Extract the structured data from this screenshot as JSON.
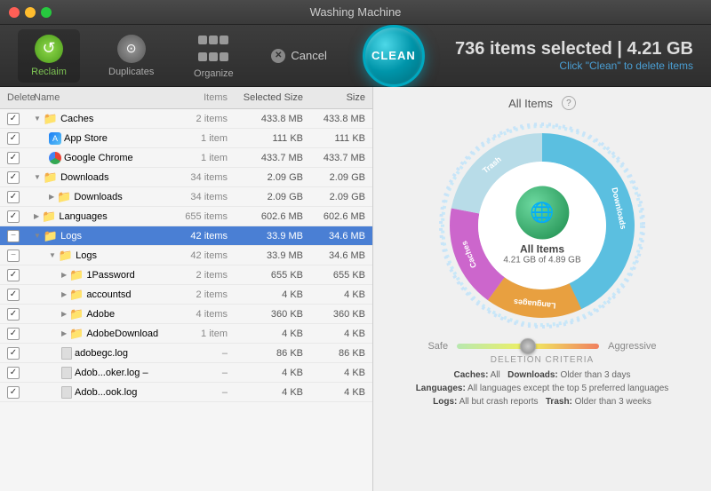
{
  "app": {
    "title": "Washing Machine"
  },
  "toolbar": {
    "reclaim_label": "Reclaim",
    "duplicates_label": "Duplicates",
    "organize_label": "Organize",
    "cancel_label": "Cancel",
    "clean_label": "CLEAN"
  },
  "header": {
    "selected_text": "736 items selected | 4.21 GB",
    "hint_text": "Click \"Clean\" to delete items"
  },
  "panel_title": "All Items",
  "columns": {
    "delete": "Delete",
    "name": "Name",
    "items": "Items",
    "selected_size": "Selected Size",
    "size": "Size"
  },
  "rows": [
    {
      "level": 0,
      "expanded": true,
      "checked": "checked",
      "name": "Caches",
      "items": "2 items",
      "selsize": "433.8 MB",
      "size": "433.8 MB",
      "type": "folder",
      "selected": false
    },
    {
      "level": 1,
      "expanded": false,
      "checked": "checked",
      "name": "App Store",
      "items": "1 item",
      "selsize": "111 KB",
      "size": "111 KB",
      "type": "app-store",
      "selected": false
    },
    {
      "level": 1,
      "expanded": false,
      "checked": "checked",
      "name": "Google Chrome",
      "items": "1 item",
      "selsize": "433.7 MB",
      "size": "433.7 MB",
      "type": "chrome",
      "selected": false
    },
    {
      "level": 0,
      "expanded": true,
      "checked": "checked",
      "name": "Downloads",
      "items": "34 items",
      "selsize": "2.09 GB",
      "size": "2.09 GB",
      "type": "folder",
      "selected": false
    },
    {
      "level": 1,
      "expanded": false,
      "checked": "checked",
      "name": "Downloads",
      "items": "34 items",
      "selsize": "2.09 GB",
      "size": "2.09 GB",
      "type": "folder",
      "selected": false
    },
    {
      "level": 0,
      "expanded": false,
      "checked": "checked",
      "name": "Languages",
      "items": "655 items",
      "selsize": "602.6 MB",
      "size": "602.6 MB",
      "type": "folder",
      "selected": false
    },
    {
      "level": 0,
      "expanded": true,
      "checked": "minus",
      "name": "Logs",
      "items": "42 items",
      "selsize": "33.9 MB",
      "size": "34.6 MB",
      "type": "folder",
      "selected": true
    },
    {
      "level": 1,
      "expanded": true,
      "checked": "minus",
      "name": "Logs",
      "items": "42 items",
      "selsize": "33.9 MB",
      "size": "34.6 MB",
      "type": "folder",
      "selected": false
    },
    {
      "level": 2,
      "expanded": false,
      "checked": "checked",
      "name": "1Password",
      "items": "2 items",
      "selsize": "655 KB",
      "size": "655 KB",
      "type": "folder",
      "selected": false
    },
    {
      "level": 2,
      "expanded": false,
      "checked": "checked",
      "name": "accountsd",
      "items": "2 items",
      "selsize": "4 KB",
      "size": "4 KB",
      "type": "folder",
      "selected": false
    },
    {
      "level": 2,
      "expanded": false,
      "checked": "checked",
      "name": "Adobe",
      "items": "4 items",
      "selsize": "360 KB",
      "size": "360 KB",
      "type": "folder",
      "selected": false
    },
    {
      "level": 2,
      "expanded": false,
      "checked": "checked",
      "name": "AdobeDownload",
      "items": "1 item",
      "selsize": "4 KB",
      "size": "4 KB",
      "type": "folder",
      "selected": false
    },
    {
      "level": 2,
      "expanded": false,
      "checked": "checked",
      "name": "adobegc.log",
      "items": "–",
      "selsize": "86 KB",
      "size": "86 KB",
      "type": "file",
      "selected": false
    },
    {
      "level": 2,
      "expanded": false,
      "checked": "checked",
      "name": "Adob...oker.log –",
      "items": "–",
      "selsize": "4 KB",
      "size": "4 KB",
      "type": "file",
      "selected": false
    },
    {
      "level": 2,
      "expanded": false,
      "checked": "checked",
      "name": "Adob...ook.log",
      "items": "–",
      "selsize": "4 KB",
      "size": "4 KB",
      "type": "file",
      "selected": false
    }
  ],
  "donut": {
    "center_label": "All Items",
    "center_sub": "4.21 GB of 4.89 GB",
    "segments": [
      {
        "name": "Downloads",
        "color": "#5bbfe0",
        "percent": 43,
        "label_angle": 200
      },
      {
        "name": "Trash",
        "color": "#a0d0e0",
        "percent": 22,
        "label_angle": 280
      },
      {
        "name": "Caches",
        "color": "#d070d0",
        "percent": 18,
        "label_angle": 40
      },
      {
        "name": "Languages",
        "color": "#e8a040",
        "percent": 17,
        "label_angle": 80
      }
    ]
  },
  "slider": {
    "safe_label": "Safe",
    "aggressive_label": "Aggressive",
    "position": 0.5
  },
  "deletion_criteria": {
    "title": "DELETION CRITERIA",
    "notes": [
      {
        "label": "Caches:",
        "text": " All"
      },
      {
        "label": " Downloads:",
        "text": " Older than 3 days"
      },
      {
        "label": "Languages:",
        "text": " All languages except the top 5 preferred languages"
      },
      {
        "label": "Logs:",
        "text": " All but crash reports"
      },
      {
        "label": " Trash:",
        "text": " Older than 3 weeks"
      }
    ]
  }
}
